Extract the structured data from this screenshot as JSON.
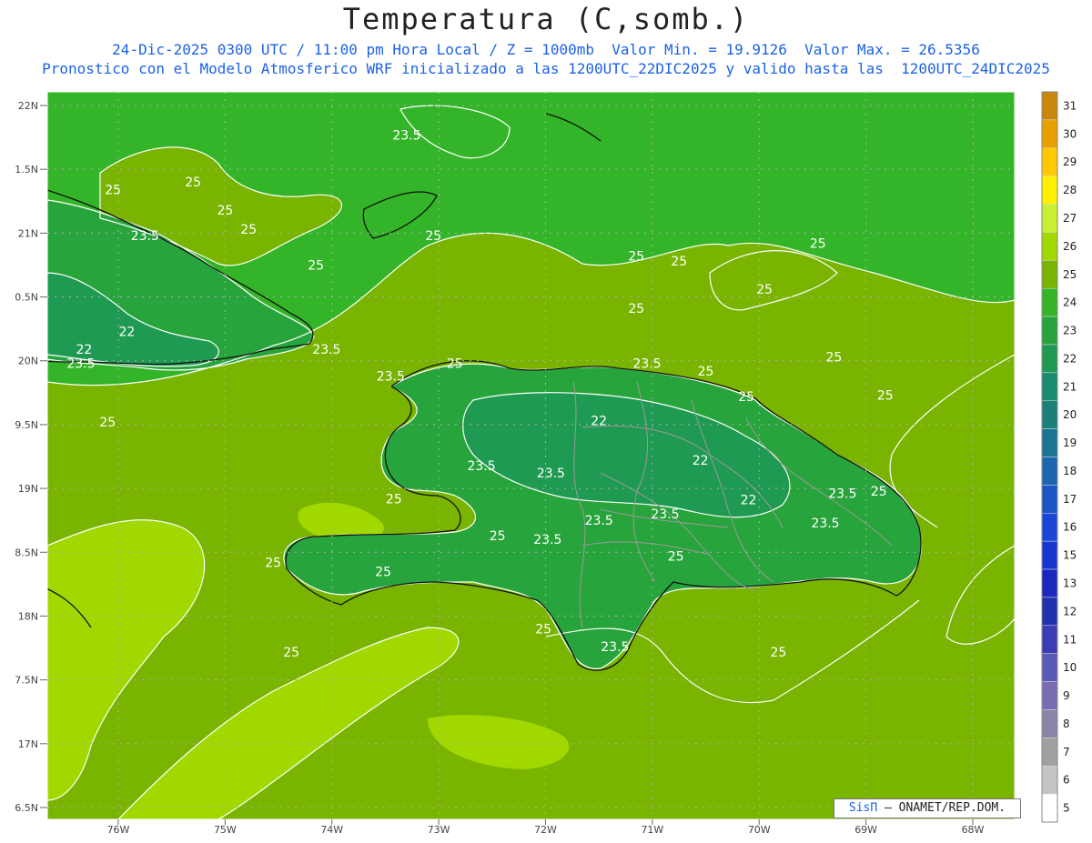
{
  "title": "Temperatura (C,somb.)",
  "subtitle": "24-Dic-2025 0300 UTC / 11:00 pm Hora Local / Z = 1000mb  Valor Min. = 19.9126  Valor Max. = 26.5356",
  "subtitle2": "Pronostico con el Modelo Atmosferico WRF inicializado a las 1200UTC_22DIC2025 y valido hasta las  1200UTC_24DIC2025",
  "credit": {
    "brand": "SisΠ",
    "text": " – ONAMET/REP.DOM."
  },
  "lat_labels": [
    "22N",
    "1.5N",
    "21N",
    "0.5N",
    "20N",
    "9.5N",
    "19N",
    "8.5N",
    "18N",
    "7.5N",
    "17N",
    "6.5N"
  ],
  "lon_labels": [
    "76W",
    "75W",
    "74W",
    "73W",
    "72W",
    "71W",
    "70W",
    "69W",
    "68W"
  ],
  "colorbar": {
    "labels": [
      "31",
      "30",
      "29",
      "28",
      "27",
      "26",
      "25",
      "24",
      "23",
      "22",
      "21",
      "20",
      "19",
      "18",
      "17",
      "16",
      "15",
      "13",
      "12",
      "11",
      "10",
      "9",
      "8",
      "7",
      "6",
      "5"
    ],
    "colors": [
      "#c8860a",
      "#e6a000",
      "#ffc800",
      "#fff000",
      "#c8f032",
      "#a0d800",
      "#78b400",
      "#34b428",
      "#28a43c",
      "#1f9a52",
      "#198c6e",
      "#1a8078",
      "#1a7494",
      "#1a66b0",
      "#1a56c8",
      "#1a46d8",
      "#1a36d0",
      "#1a28c0",
      "#2030b0",
      "#3c3cb4",
      "#5a5ab8",
      "#7a6cb4",
      "#8a84a8",
      "#a0a0a0",
      "#c4c4c4",
      "#ffffff"
    ]
  },
  "contour_labels": [
    {
      "text": "25",
      "lon": -75.3,
      "lat": 21.4
    },
    {
      "text": "25",
      "lon": -76.05,
      "lat": 21.34
    },
    {
      "text": "25",
      "lon": -75.0,
      "lat": 21.18
    },
    {
      "text": "23.5",
      "lon": -75.75,
      "lat": 20.98
    },
    {
      "text": "25",
      "lon": -74.78,
      "lat": 21.03
    },
    {
      "text": "25",
      "lon": -73.05,
      "lat": 20.98
    },
    {
      "text": "23.5",
      "lon": -73.3,
      "lat": 21.77
    },
    {
      "text": "25",
      "lon": -74.15,
      "lat": 20.75
    },
    {
      "text": "22",
      "lon": -75.92,
      "lat": 20.23
    },
    {
      "text": "22",
      "lon": -76.32,
      "lat": 20.09
    },
    {
      "text": "23.5",
      "lon": -76.35,
      "lat": 19.98
    },
    {
      "text": "23.5",
      "lon": -74.05,
      "lat": 20.09
    },
    {
      "text": "25",
      "lon": -76.1,
      "lat": 19.52
    },
    {
      "text": "25",
      "lon": -71.15,
      "lat": 20.82
    },
    {
      "text": "25",
      "lon": -70.75,
      "lat": 20.78
    },
    {
      "text": "25",
      "lon": -69.45,
      "lat": 20.92
    },
    {
      "text": "25",
      "lon": -69.95,
      "lat": 20.56
    },
    {
      "text": "25",
      "lon": -71.15,
      "lat": 20.41
    },
    {
      "text": "23.5",
      "lon": -71.05,
      "lat": 19.98
    },
    {
      "text": "25",
      "lon": -70.5,
      "lat": 19.92
    },
    {
      "text": "25",
      "lon": -69.3,
      "lat": 20.03
    },
    {
      "text": "25",
      "lon": -70.12,
      "lat": 19.72
    },
    {
      "text": "25",
      "lon": -68.82,
      "lat": 19.73
    },
    {
      "text": "23.5",
      "lon": -73.45,
      "lat": 19.88
    },
    {
      "text": "25",
      "lon": -72.85,
      "lat": 19.98
    },
    {
      "text": "22",
      "lon": -71.5,
      "lat": 19.53
    },
    {
      "text": "22",
      "lon": -70.55,
      "lat": 19.22
    },
    {
      "text": "23.5",
      "lon": -72.6,
      "lat": 19.18
    },
    {
      "text": "23.5",
      "lon": -71.95,
      "lat": 19.12
    },
    {
      "text": "22",
      "lon": -70.1,
      "lat": 18.91
    },
    {
      "text": "23.5",
      "lon": -69.22,
      "lat": 18.96
    },
    {
      "text": "25",
      "lon": -68.88,
      "lat": 18.98
    },
    {
      "text": "23.5",
      "lon": -71.5,
      "lat": 18.75
    },
    {
      "text": "23.5",
      "lon": -70.88,
      "lat": 18.8
    },
    {
      "text": "23.5",
      "lon": -69.38,
      "lat": 18.73
    },
    {
      "text": "25",
      "lon": -73.42,
      "lat": 18.92
    },
    {
      "text": "25",
      "lon": -72.45,
      "lat": 18.63
    },
    {
      "text": "23.5",
      "lon": -71.98,
      "lat": 18.6
    },
    {
      "text": "25",
      "lon": -74.55,
      "lat": 18.42
    },
    {
      "text": "25",
      "lon": -73.52,
      "lat": 18.35
    },
    {
      "text": "25",
      "lon": -70.78,
      "lat": 18.47
    },
    {
      "text": "25",
      "lon": -72.02,
      "lat": 17.9
    },
    {
      "text": "23.5",
      "lon": -71.35,
      "lat": 17.76
    },
    {
      "text": "25",
      "lon": -74.38,
      "lat": 17.72
    },
    {
      "text": "25",
      "lon": -69.82,
      "lat": 17.72
    }
  ]
}
